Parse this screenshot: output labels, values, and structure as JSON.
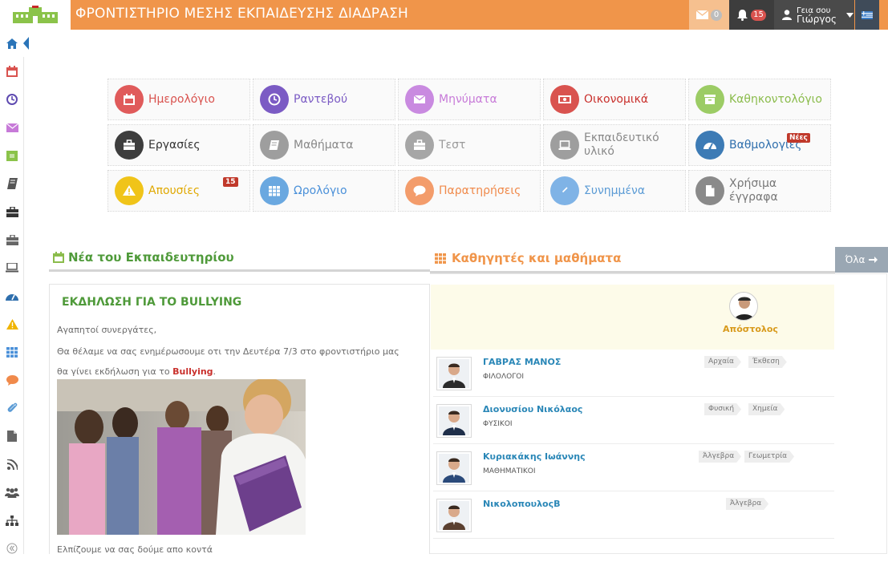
{
  "app": {
    "title": "ΦΡΟΝΤΙΣΤΗΡΙΟ ΜΕΣΗΣ ΕΚΠΑΙΔΕΥΣΗΣ ΔΙΑΔΡΑΣΗ"
  },
  "topbar": {
    "messages_count": "0",
    "notifications_count": "15",
    "greeting": "Γεια σου",
    "user_name": "Γιώργος"
  },
  "sidebar": {
    "icons": [
      "home-icon",
      "calendar-icon",
      "clock-icon",
      "envelope-icon",
      "cash-icon",
      "book-icon",
      "briefcase-icon",
      "briefcase-outline-icon",
      "laptop-icon",
      "dashboard-icon",
      "warning-icon",
      "grid-icon",
      "comment-icon",
      "paperclip-icon",
      "file-icon",
      "rss-icon",
      "users-icon",
      "sitemap-icon",
      "collapse-icon"
    ]
  },
  "tiles": [
    {
      "label": "Ημερολόγιο",
      "color": "#e05b5b",
      "text_color": "#d9534f",
      "icon": "calendar-icon"
    },
    {
      "label": "Ραντεβού",
      "color": "#7b5bc4",
      "text_color": "#7b5bc4",
      "icon": "clock-icon"
    },
    {
      "label": "Μηνύματα",
      "color": "#c98ae0",
      "text_color": "#c77ad8",
      "icon": "envelope-icon"
    },
    {
      "label": "Οικονομικά",
      "color": "#d9534f",
      "text_color": "#c9302c",
      "icon": "money-icon"
    },
    {
      "label": "Καθηκοντολόγιο",
      "color": "#9ccc65",
      "text_color": "#8bbc4c",
      "icon": "archive-icon"
    },
    {
      "label": "Εργασίες",
      "color": "#3d3d3d",
      "text_color": "#333333",
      "icon": "briefcase-icon"
    },
    {
      "label": "Μαθήματα",
      "color": "#9e9e9e",
      "text_color": "#888888",
      "icon": "book-icon"
    },
    {
      "label": "Τεστ",
      "color": "#a6a6a6",
      "text_color": "#999999",
      "icon": "briefcase-outline-icon"
    },
    {
      "label": "Εκπαιδευτικό υλικό",
      "line1": "Εκπαιδευτικό",
      "line2": "υλικό",
      "color": "#9e9e9e",
      "text_color": "#888888",
      "icon": "laptop-icon"
    },
    {
      "label": "Βαθμολογίες",
      "color": "#3d7bb5",
      "text_color": "#2f6fad",
      "icon": "dashboard-icon",
      "badge": "Νέες"
    },
    {
      "label": "Απουσίες",
      "color": "#f0c419",
      "text_color": "#e0a800",
      "icon": "warning-icon",
      "badge": "15"
    },
    {
      "label": "Ωρολόγιο",
      "color": "#6aa8e0",
      "text_color": "#4a90d9",
      "icon": "grid-icon"
    },
    {
      "label": "Παρατηρήσεις",
      "color": "#f39c6b",
      "text_color": "#f08a4b",
      "icon": "comment-icon"
    },
    {
      "label": "Συνημμένα",
      "color": "#7fb3e6",
      "text_color": "#5b9bd5",
      "icon": "paperclip-icon"
    },
    {
      "label": "Χρήσιμα έγγραφα",
      "line1": "Χρήσιμα",
      "line2": "έγγραφα",
      "color": "#8a8a8a",
      "text_color": "#777777",
      "icon": "file-icon"
    }
  ],
  "news": {
    "heading": "Νέα του Εκπαιδευτηρίου",
    "title": "ΕΚΔΗΛΩΣΗ ΓΙΑ ΤΟ BULLYING",
    "p1": "Αγαπητοί συνεργάτες,",
    "p2": "Θα θέλαμε να σας ενημέρωσουμε οτι την Δευτέρα 7/3 στο φροντιστήριο μας",
    "p3_prefix": "θα γίνει εκδήλωση για το ",
    "p3_highlight": "Bullying",
    "p3_suffix": ".",
    "p4": "Ελπίζουμε να σας δούμε απο κοντά"
  },
  "teachers": {
    "heading": "Καθηγητές και μαθήματα",
    "all_button": "Όλα",
    "featured_name": "Απόστολος",
    "rows": [
      {
        "name": "ΓΑΒΡΑΣ ΜΑΝΟΣ",
        "role": "ΦΙΛΟΛΟΓΟΙ",
        "tags": [
          "Αρχαία",
          "Έκθεση"
        ]
      },
      {
        "name": "Διονυσίου Νικόλαος",
        "role": "ΦΥΣΙΚΟΙ",
        "tags": [
          "Φυσική",
          "Χημεία"
        ]
      },
      {
        "name": "Κυριακάκης Ιωάννης",
        "role": "ΜΑΘΗΜΑΤΙΚΟΙ",
        "tags": [
          "Άλγεβρα",
          "Γεωμετρία"
        ]
      },
      {
        "name": "ΝικολοπουλοςΒ",
        "role": "",
        "tags": [
          "Άλγεβρα"
        ]
      }
    ]
  }
}
